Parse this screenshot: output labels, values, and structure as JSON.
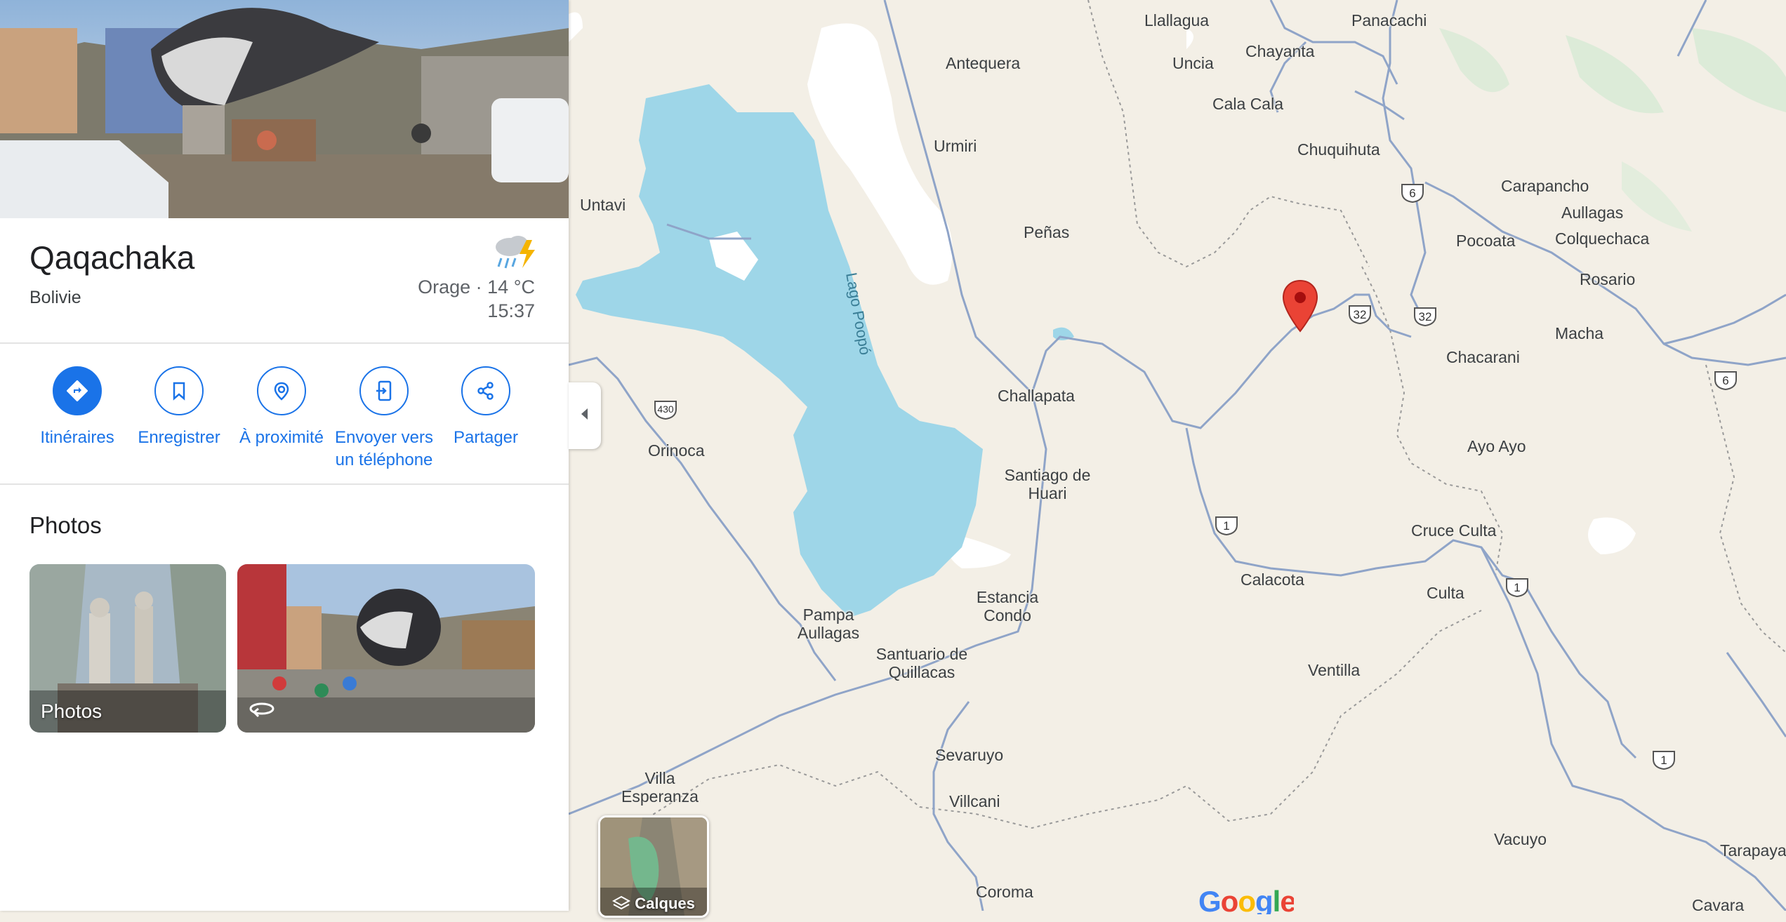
{
  "place": {
    "name": "Qaqachaka",
    "country": "Bolivie"
  },
  "weather": {
    "icon": "thunderstorm-icon",
    "condition": "Orage · 14 °C",
    "time": "15:37"
  },
  "actions": [
    {
      "label": "Itinéraires",
      "icon": "directions-icon"
    },
    {
      "label": "Enregistrer",
      "icon": "bookmark-icon"
    },
    {
      "label": "À proximité",
      "icon": "nearby-icon"
    },
    {
      "label": "Envoyer vers un téléphone",
      "icon": "send-to-phone-icon"
    },
    {
      "label": "Partager",
      "icon": "share-icon"
    }
  ],
  "photos": {
    "title": "Photos",
    "thumb_label": "Photos"
  },
  "map": {
    "lake_label": "Lago Poopó",
    "places": [
      "Llallagua",
      "Panacachi",
      "Antequera",
      "Uncia",
      "Chayanta",
      "Cala Cala",
      "Urmiri",
      "Chuquihuta",
      "Untavi",
      "Peñas",
      "Carapancho",
      "Aullagas",
      "Pocoata",
      "Colquechaca",
      "Rosario",
      "Macha",
      "Chacarani",
      "Challapata",
      "Orinoca",
      "Santiago de Huari",
      "Ayo Ayo",
      "Cruce Culta",
      "Calacota",
      "Culta",
      "Estancia Condo",
      "Pampa Aullagas",
      "Santuario de Quillacas",
      "Ventilla",
      "Sevaruyo",
      "Villa Esperanza",
      "Villcani",
      "Vacuyo",
      "Tarapaya",
      "Coroma",
      "Cavara"
    ],
    "routes": [
      "6",
      "32",
      "430",
      "1",
      "1",
      "1",
      "6",
      "1"
    ],
    "layers_label": "Calques",
    "logo": "Google",
    "colors": {
      "water": "#9ed6e8",
      "land": "#f3efe6",
      "road": "#8fa4c8",
      "marker": "#ea4335",
      "accent": "#1a73e8"
    }
  }
}
